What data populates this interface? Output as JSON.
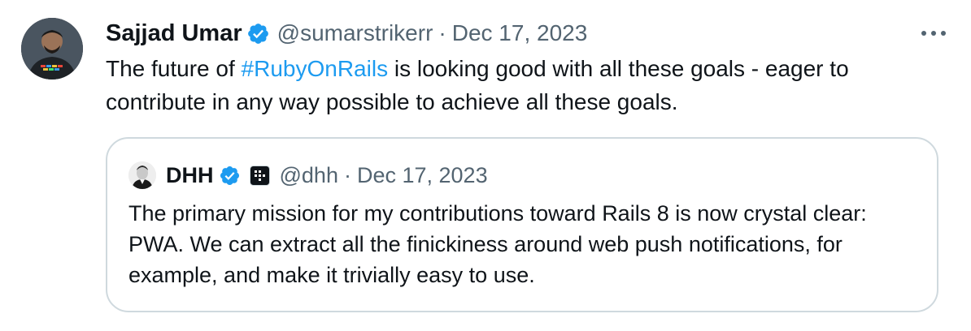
{
  "tweet": {
    "author_name": "Sajjad Umar",
    "handle": "@sumarstrikerr",
    "separator": "·",
    "date": "Dec 17, 2023",
    "avatar_icon": "user-avatar-icon",
    "verified_icon": "verified-badge-icon",
    "more_icon": "more-options-icon",
    "text_before": "The future of ",
    "hashtag": "#RubyOnRails",
    "text_after": " is looking good with all these goals - eager to contribute in any way possible to achieve all these goals."
  },
  "quoted": {
    "author_name": "DHH",
    "handle": "@dhh",
    "separator": "·",
    "date": "Dec 17, 2023",
    "avatar_icon": "quoted-avatar-icon",
    "verified_icon": "verified-badge-icon",
    "affiliate_icon": "affiliate-badge-icon",
    "text": "The primary mission for my contributions toward Rails 8 is now crystal clear: PWA. We can extract all the finickiness around web push notifications, for example, and make it trivially easy to use."
  },
  "colors": {
    "accent": "#1d9bf0",
    "secondary_text": "#536471",
    "primary_text": "#0f1419",
    "border": "#cfd9de"
  }
}
